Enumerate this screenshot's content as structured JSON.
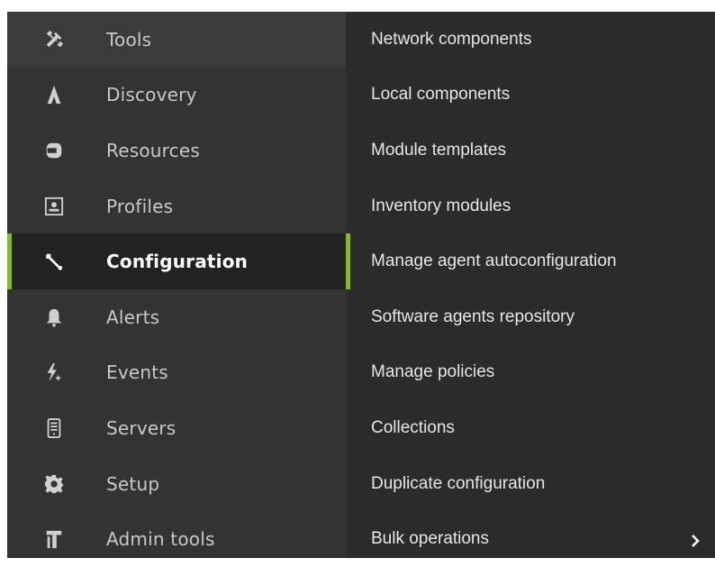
{
  "colors": {
    "accent": "#82b92e",
    "main_bg": "#333333",
    "sub_bg": "#2b2b2b",
    "active_bg": "#222222"
  },
  "main_menu": {
    "items": [
      {
        "label": "Tools",
        "icon": "tools-icon"
      },
      {
        "label": "Discovery",
        "icon": "discovery-icon"
      },
      {
        "label": "Resources",
        "icon": "resources-icon"
      },
      {
        "label": "Profiles",
        "icon": "profile-icon"
      },
      {
        "label": "Configuration",
        "icon": "wrench-icon",
        "active": true
      },
      {
        "label": "Alerts",
        "icon": "bell-icon"
      },
      {
        "label": "Events",
        "icon": "events-bolt-icon"
      },
      {
        "label": "Servers",
        "icon": "server-icon"
      },
      {
        "label": "Setup",
        "icon": "gear-icon"
      },
      {
        "label": "Admin tools",
        "icon": "admin-tools-icon"
      }
    ]
  },
  "sub_menu": {
    "items": [
      {
        "label": "Network components"
      },
      {
        "label": "Local components"
      },
      {
        "label": "Module templates"
      },
      {
        "label": "Inventory modules"
      },
      {
        "label": "Manage agent autoconfiguration",
        "active": true
      },
      {
        "label": "Software agents repository"
      },
      {
        "label": "Manage policies"
      },
      {
        "label": "Collections"
      },
      {
        "label": "Duplicate configuration"
      },
      {
        "label": "Bulk operations",
        "has_submenu": true
      }
    ]
  }
}
